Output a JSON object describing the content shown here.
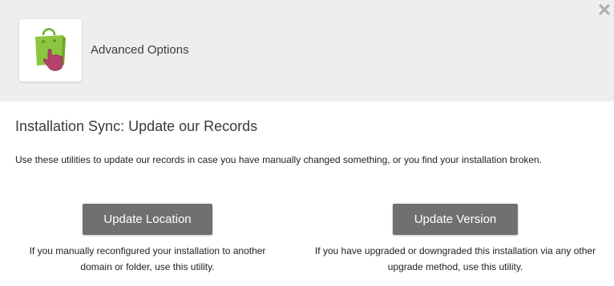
{
  "header": {
    "title": "Advanced Options",
    "logo_icon": "shopping-bag-hand-icon",
    "close_icon": "close-icon"
  },
  "section": {
    "title": "Installation Sync: Update our Records",
    "description": "Use these utilities to update our records in case you have manually changed something, or you find your installation broken."
  },
  "utilities": [
    {
      "label": "Update Location",
      "help_line1": "If you manually reconfigured your installation to another",
      "help_line2": "domain or folder, use this utility."
    },
    {
      "label": "Update Version",
      "help_line1": "If you have upgraded or downgraded this installation via any other",
      "help_line2": "upgrade method, use this utility."
    }
  ],
  "colors": {
    "header_bg": "#eeeeee",
    "button_bg": "#707070",
    "bag_green": "#8cc63f",
    "hand_pink": "#b5426e"
  }
}
